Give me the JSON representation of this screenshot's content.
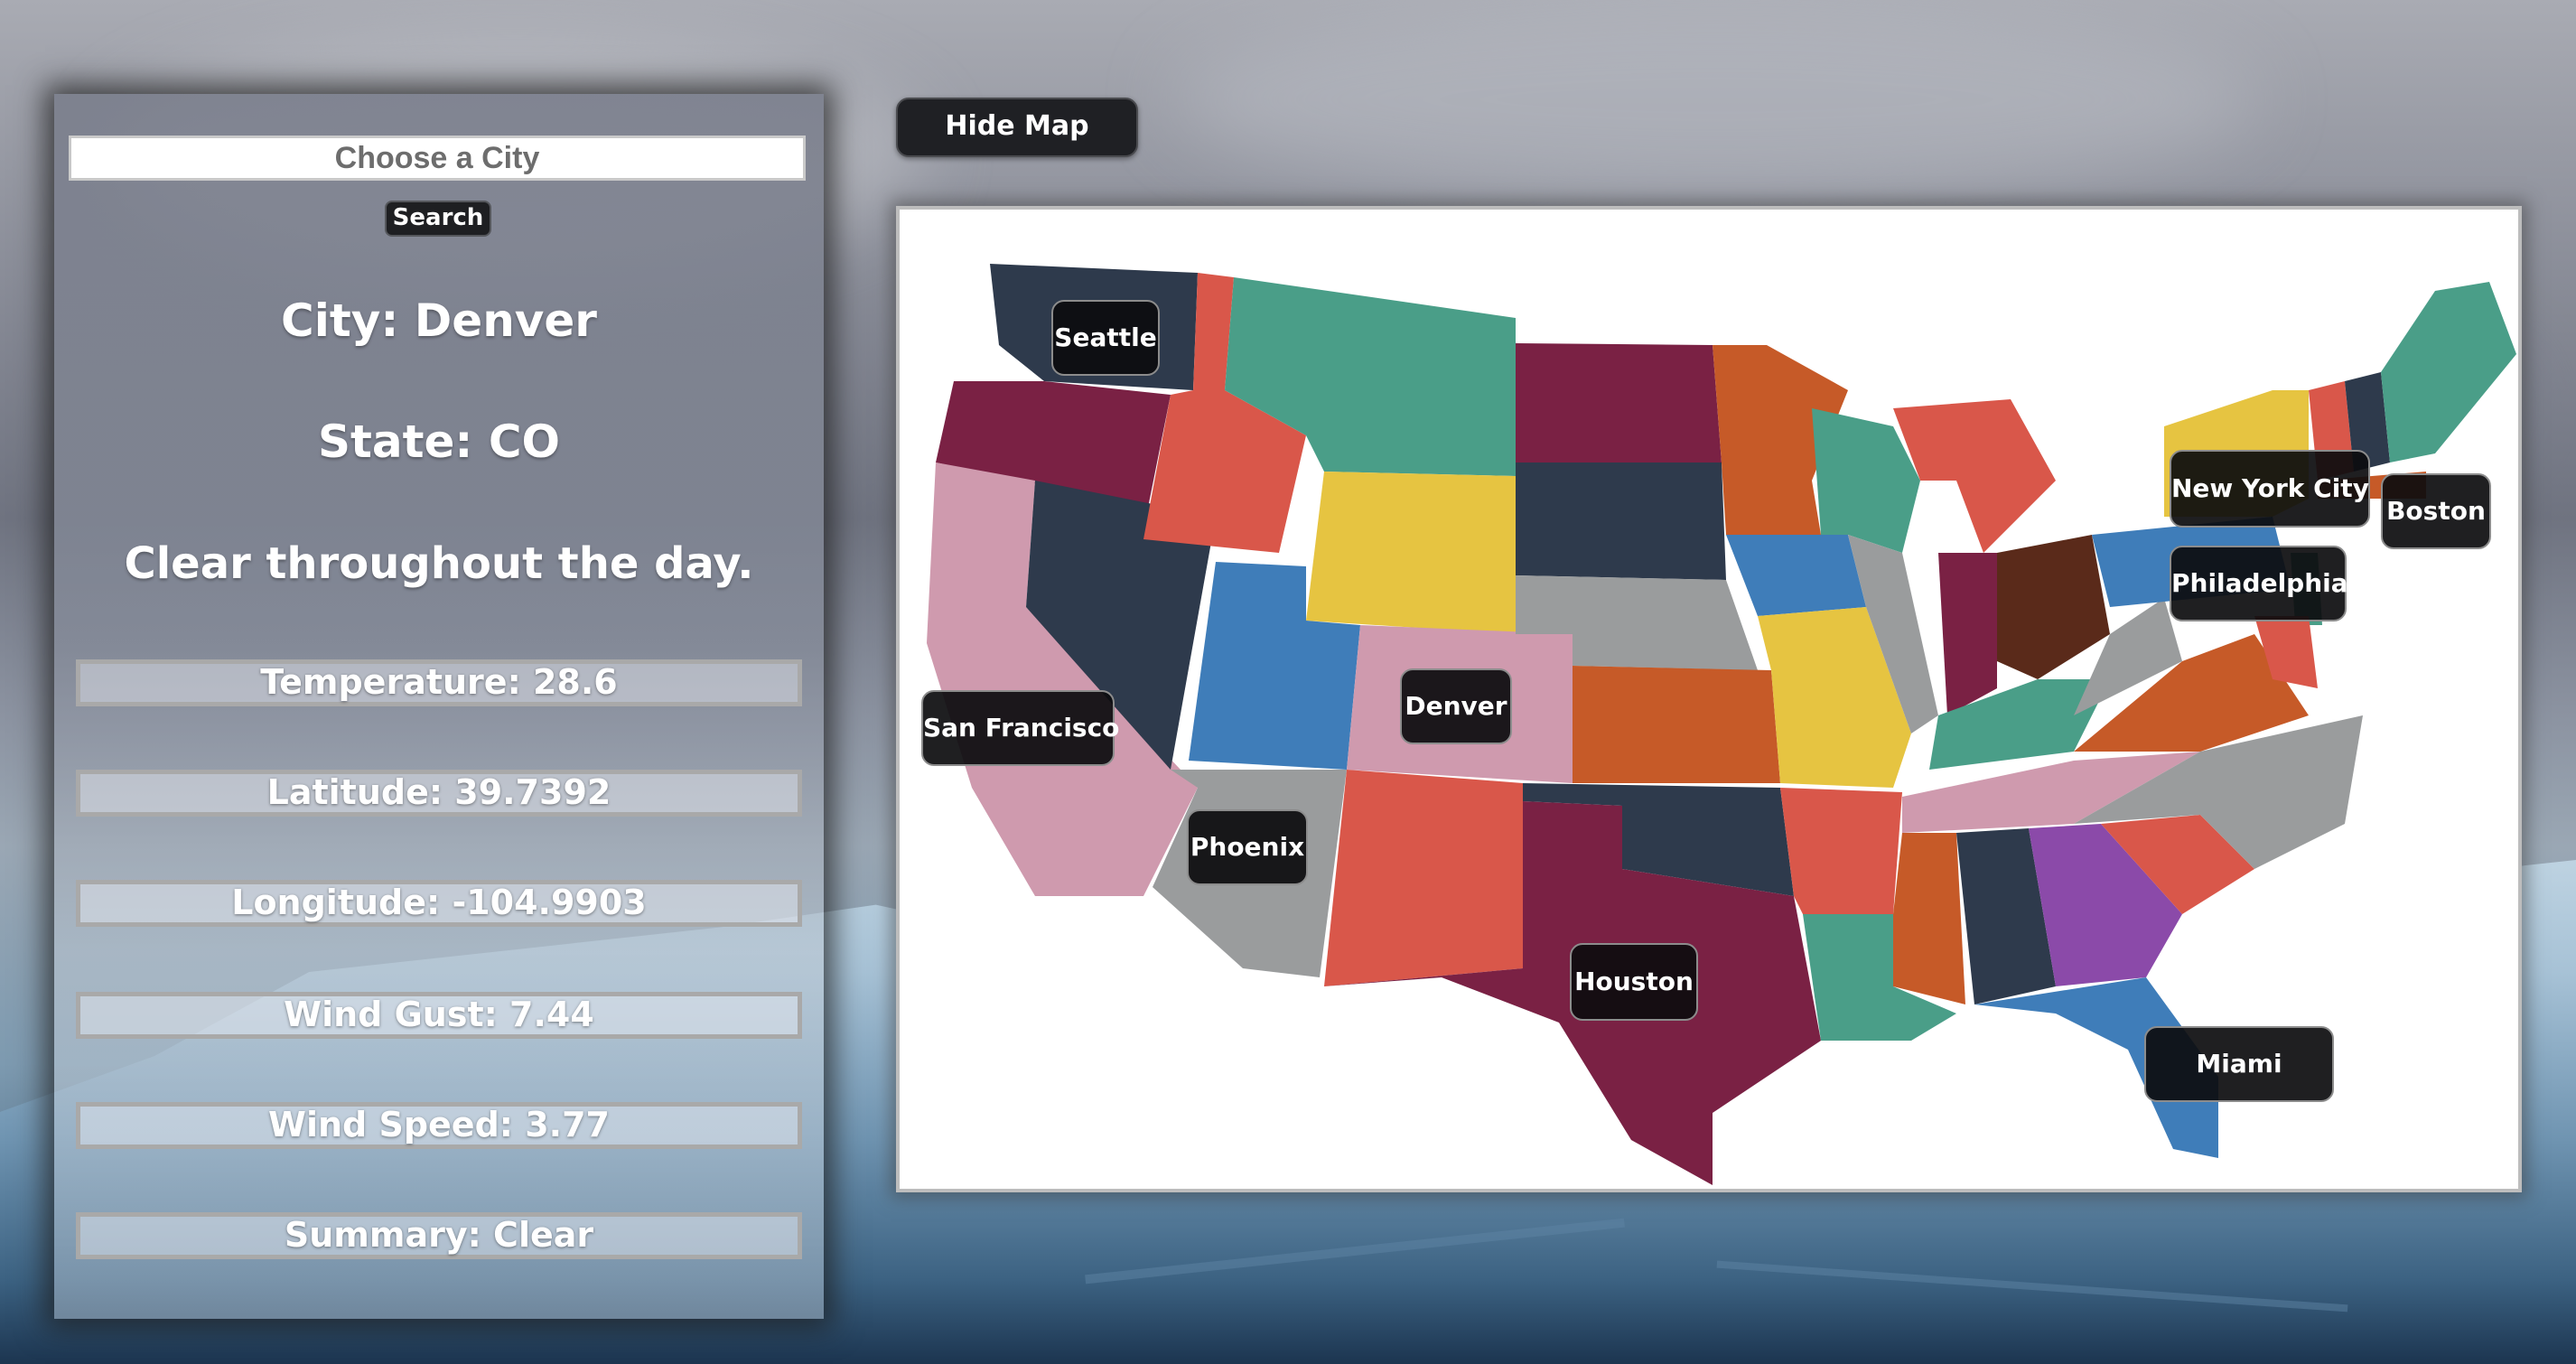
{
  "search": {
    "placeholder": "Choose a City",
    "button_label": "Search"
  },
  "weather": {
    "city": "City: Denver",
    "state": "State: CO",
    "summary_text": "Clear throughout the day.",
    "stats": [
      {
        "label": "Temperature: 28.6"
      },
      {
        "label": "Latitude: 39.7392"
      },
      {
        "label": "Longitude: -104.9903"
      },
      {
        "label": "Wind Gust: 7.44"
      },
      {
        "label": "Wind Speed: 3.77"
      },
      {
        "label": "Summary: Clear"
      }
    ]
  },
  "map": {
    "toggle_label": "Hide Map",
    "cities": [
      {
        "name": "Seattle"
      },
      {
        "name": "San Francisco"
      },
      {
        "name": "Phoenix"
      },
      {
        "name": "Denver"
      },
      {
        "name": "Houston"
      },
      {
        "name": "New York City"
      },
      {
        "name": "Boston"
      },
      {
        "name": "Philadelphia"
      },
      {
        "name": "Miami"
      }
    ]
  },
  "colors": {
    "button_bg": "#1f2024",
    "teal": "#4a9e88",
    "maroon": "#7a2144",
    "orange": "#c65a28",
    "red": "#d9574a",
    "navy": "#2e3a4c",
    "yellow": "#e6c441",
    "blue": "#3f7db9",
    "pink": "#cf9aae",
    "gray": "#9a9c9d",
    "purple": "#8b4aa9",
    "brown": "#5a2a1a"
  }
}
